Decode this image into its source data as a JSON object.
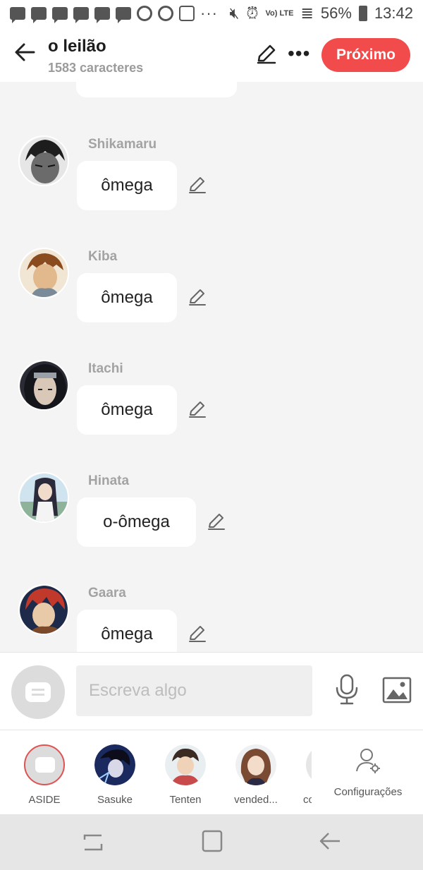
{
  "status_bar": {
    "battery": "56%",
    "time": "13:42",
    "network_label": "Vo) LTE"
  },
  "header": {
    "title": "o leilão",
    "subtitle": "1583 caracteres",
    "next_label": "Próximo"
  },
  "messages": [
    {
      "sender": "Shikamaru",
      "text": "ômega",
      "avatar_color": "#3a3a3a"
    },
    {
      "sender": "Kiba",
      "text": "ômega",
      "avatar_color": "#b98a5a"
    },
    {
      "sender": "Itachi",
      "text": "ômega",
      "avatar_color": "#2b2b35"
    },
    {
      "sender": "Hinata",
      "text": "o-ômega",
      "avatar_color": "#8fb3c7"
    },
    {
      "sender": "Gaara",
      "text": "ômega",
      "avatar_color": "#b83b2a"
    }
  ],
  "composer": {
    "placeholder": "Escreva algo"
  },
  "personas": [
    {
      "label": "ASIDE"
    },
    {
      "label": "Sasuke"
    },
    {
      "label": "Tenten"
    },
    {
      "label": "vended..."
    },
    {
      "label": "co"
    }
  ],
  "settings_label": "Configurações",
  "colors": {
    "accent": "#f24b4b",
    "bubble": "#ffffff",
    "background": "#f4f4f4"
  }
}
